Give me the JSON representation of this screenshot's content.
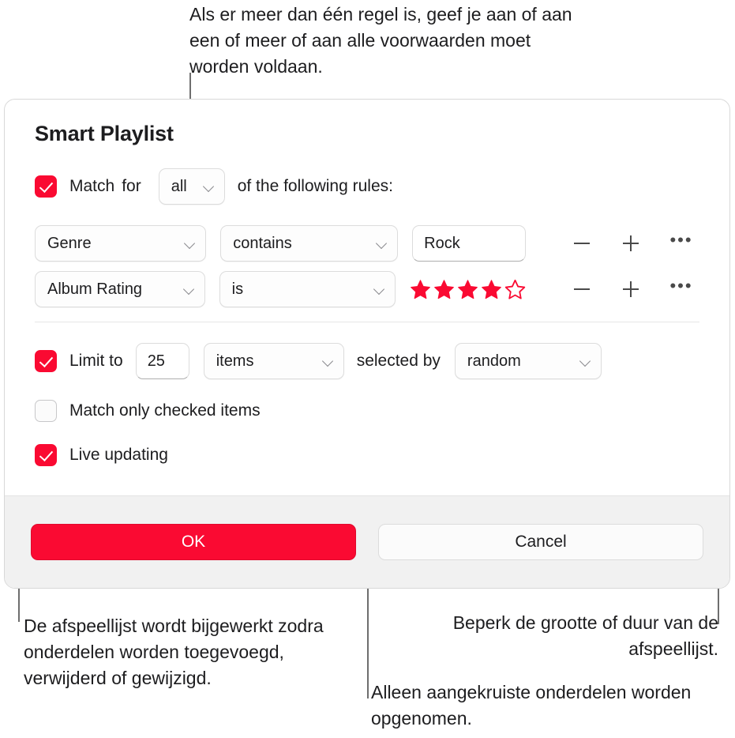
{
  "theme": {
    "accent": "#fa0a32",
    "text": "#1d1d1f",
    "line": "#6e6e6e",
    "footer_bg": "#f1f1f1"
  },
  "callouts": {
    "top": "Als er meer dan één regel is, geef je aan of aan een of meer of aan alle voorwaarden moet worden voldaan.",
    "live_updating": "De afspeellijst wordt bijgewerkt zodra onderdelen worden toegevoegd, verwijderd of gewijzigd.",
    "limit": "Beperk de grootte of duur van de afspeellijst.",
    "checked_items": "Alleen aangekruiste onderdelen worden opgenomen."
  },
  "dialog": {
    "title": "Smart Playlist",
    "match": {
      "checked": true,
      "label": "Match",
      "for_label": "for",
      "selected": "all",
      "suffix": "of the following rules:"
    },
    "rules": [
      {
        "field": "Genre",
        "operator": "contains",
        "value_type": "text",
        "value": "Rock",
        "remove": "−",
        "add": "+",
        "more": "•••"
      },
      {
        "field": "Album Rating",
        "operator": "is",
        "value_type": "rating",
        "rating": 4,
        "rating_max": 5,
        "remove": "−",
        "add": "+",
        "more": "•••"
      }
    ],
    "limit": {
      "checked": true,
      "label": "Limit to",
      "amount": "25",
      "unit": "items",
      "selected_by_label": "selected by",
      "selected_by": "random"
    },
    "match_only_checked": {
      "checked": false,
      "label": "Match only checked items"
    },
    "live_updating": {
      "checked": true,
      "label": "Live updating"
    },
    "footer": {
      "ok": "OK",
      "cancel": "Cancel"
    }
  }
}
